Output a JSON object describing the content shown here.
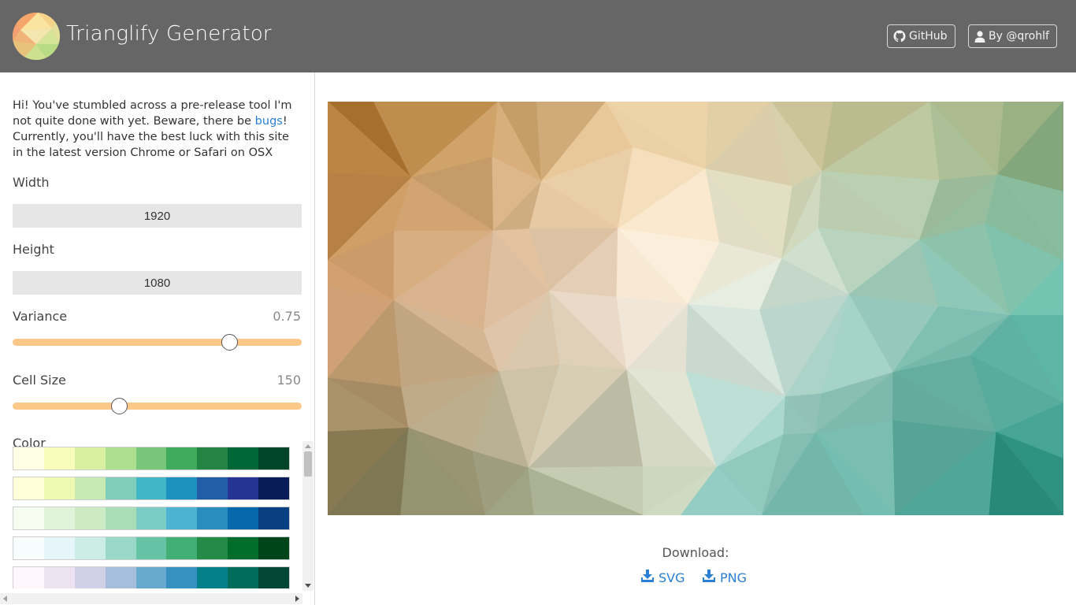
{
  "app": {
    "title": "Trianglify Generator"
  },
  "header": {
    "github_label": "GitHub",
    "author_label": "By @qrohlf"
  },
  "sidebar": {
    "intro_text_1": "Hi! You've stumbled across a pre-release tool I'm not quite done with yet. Beware, there be ",
    "intro_link": "bugs",
    "intro_text_2": "! Currently, you'll have the best luck with this site in the latest version Chrome or Safari on OSX",
    "width_label": "Width",
    "width_value": "1920",
    "height_label": "Height",
    "height_value": "1080",
    "variance_label": "Variance",
    "variance_value": "0.75",
    "variance_fraction": 0.75,
    "cell_size_label": "Cell Size",
    "cell_size_value": "150",
    "cell_size_fraction": 0.37,
    "color_label": "Color",
    "palettes": [
      [
        "#ffffe5",
        "#f7fcb9",
        "#d9f0a3",
        "#addd8e",
        "#78c679",
        "#41ab5d",
        "#238443",
        "#006837",
        "#004529"
      ],
      [
        "#ffffd9",
        "#edf8b1",
        "#c7e9b4",
        "#7fcdbb",
        "#41b6c4",
        "#1d91c0",
        "#225ea8",
        "#253494",
        "#081d58"
      ],
      [
        "#f7fcf0",
        "#e0f3db",
        "#ccebc5",
        "#a8ddb5",
        "#7bccc4",
        "#4eb3d3",
        "#2b8cbe",
        "#0868ac",
        "#084081"
      ],
      [
        "#f7fcfd",
        "#e5f5f9",
        "#ccece6",
        "#99d8c9",
        "#66c2a4",
        "#41ae76",
        "#238b45",
        "#006d2c",
        "#00441b"
      ],
      [
        "#fff7fb",
        "#ece2f0",
        "#d0d1e6",
        "#a6bddb",
        "#67a9cf",
        "#3690c0",
        "#02818a",
        "#016c59",
        "#014636"
      ]
    ]
  },
  "main": {
    "download_label": "Download:",
    "svg_label": "SVG",
    "png_label": "PNG",
    "preview_colors": [
      "#a3661b",
      "#e6a460",
      "#f0d6a8",
      "#f3eee6",
      "#bfe6df",
      "#5fb9a8",
      "#17806f",
      "#6b6a44",
      "#d4a070"
    ]
  },
  "colors": {
    "header_bg": "#666666",
    "slider_track": "#fcc88a",
    "link": "#2a7fd4"
  },
  "icons": {
    "github": "github-icon",
    "user": "user-icon",
    "download": "download-icon"
  }
}
